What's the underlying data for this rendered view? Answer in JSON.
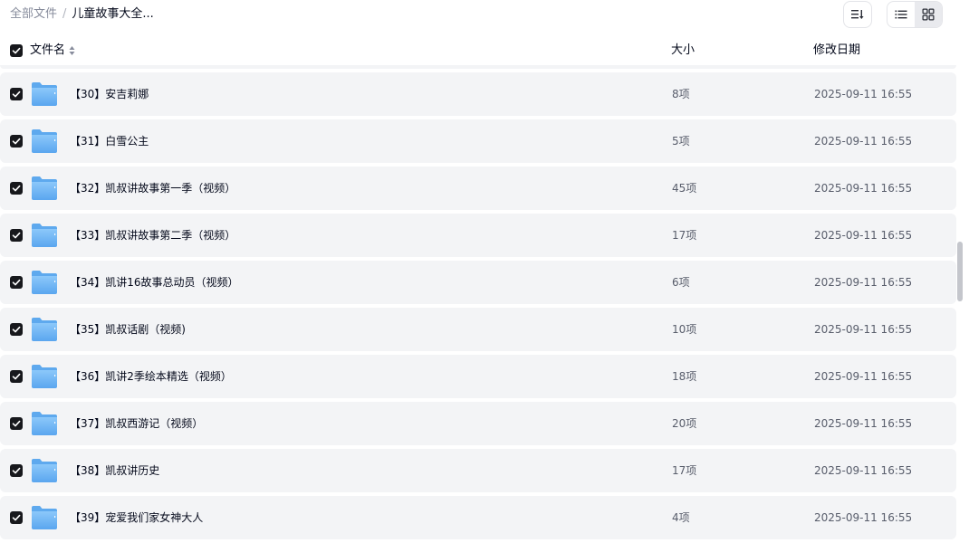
{
  "breadcrumb": {
    "root": "全部文件",
    "separator": "/",
    "current": "儿童故事大全..."
  },
  "toolbar": {
    "sort_icon": "sort-icon",
    "list_view_icon": "list-view-icon",
    "grid_view_icon": "grid-view-icon",
    "active_view": "grid"
  },
  "table": {
    "columns": {
      "name": "文件名",
      "size": "大小",
      "modified": "修改日期"
    },
    "rows": [
      {
        "name": "【30】安吉莉娜",
        "size": "8项",
        "modified": "2025-09-11 16:55",
        "checked": true
      },
      {
        "name": "【31】白雪公主",
        "size": "5项",
        "modified": "2025-09-11 16:55",
        "checked": true
      },
      {
        "name": "【32】凯叔讲故事第一季（视频）",
        "size": "45项",
        "modified": "2025-09-11 16:55",
        "checked": true
      },
      {
        "name": "【33】凯叔讲故事第二季（视频）",
        "size": "17项",
        "modified": "2025-09-11 16:55",
        "checked": true
      },
      {
        "name": "【34】凯讲16故事总动员（视频）",
        "size": "6项",
        "modified": "2025-09-11 16:55",
        "checked": true
      },
      {
        "name": "【35】凯叔话剧（视频)",
        "size": "10项",
        "modified": "2025-09-11 16:55",
        "checked": true
      },
      {
        "name": "【36】凯讲2季绘本精选（视频）",
        "size": "18项",
        "modified": "2025-09-11 16:55",
        "checked": true
      },
      {
        "name": "【37】凯叔西游记（视频）",
        "size": "20项",
        "modified": "2025-09-11 16:55",
        "checked": true
      },
      {
        "name": "【38】凯叔讲历史",
        "size": "17项",
        "modified": "2025-09-11 16:55",
        "checked": true
      },
      {
        "name": "【39】宠爱我们家女神大人",
        "size": "4项",
        "modified": "2025-09-11 16:55",
        "checked": true
      }
    ]
  },
  "colors": {
    "row_background": "#f3f4f6",
    "checkbox": "#17181c",
    "folder": "#6fb3f2"
  }
}
